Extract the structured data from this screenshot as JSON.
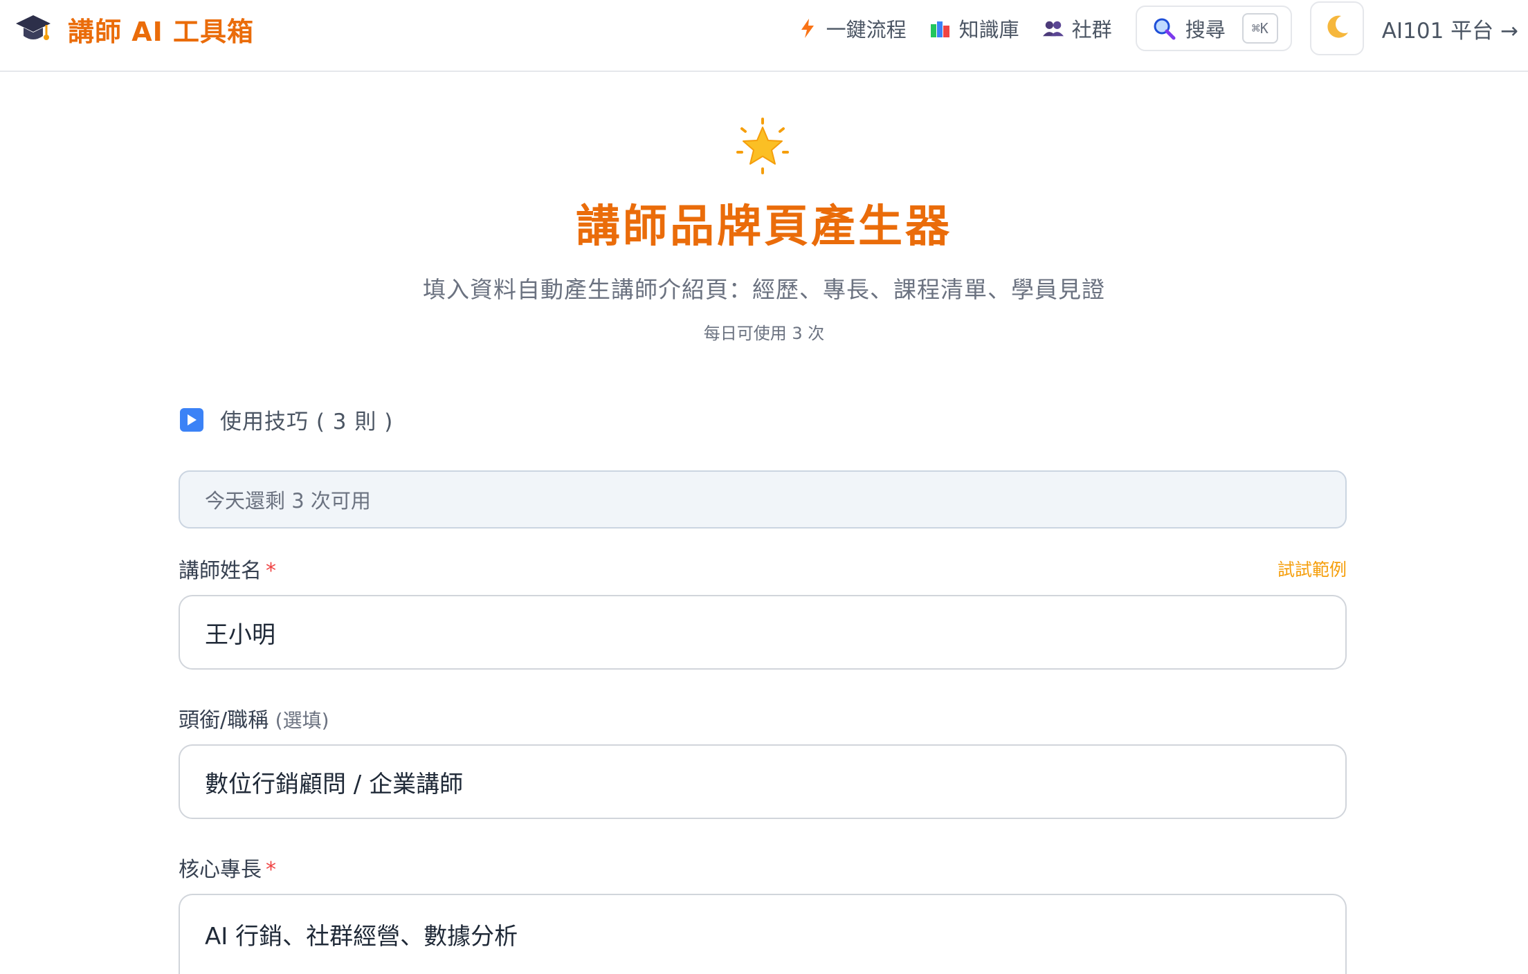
{
  "header": {
    "brand_title": "講師 AI 工具箱",
    "nav": {
      "workflow": "一鍵流程",
      "knowledge": "知識庫",
      "community": "社群"
    },
    "search": {
      "label": "搜尋",
      "shortcut": "⌘K"
    },
    "theme_icon": "moon-icon",
    "platform_link": "AI101 平台 →"
  },
  "hero": {
    "icon": "star-icon",
    "title": "講師品牌頁產生器",
    "subtitle": "填入資料自動產生講師介紹頁：經歷、專長、課程清單、學員見證",
    "usage_note": "每日可使用 3 次"
  },
  "tips": {
    "label": "使用技巧 ( 3 則 )"
  },
  "form": {
    "quota_text": "今天還剩 3 次可用",
    "example_link": "試試範例",
    "name": {
      "label": "講師姓名",
      "required_mark": "*",
      "value": "王小明"
    },
    "title": {
      "label": "頭銜/職稱",
      "optional": "(選填)",
      "value": "數位行銷顧問 / 企業講師"
    },
    "expertise": {
      "label": "核心專長",
      "required_mark": "*",
      "value": "AI 行銷、社群經營、數據分析"
    }
  },
  "colors": {
    "accent": "#ea6c0a",
    "link": "#f59e0b",
    "required": "#ef4444",
    "muted_text": "#6b7280"
  }
}
